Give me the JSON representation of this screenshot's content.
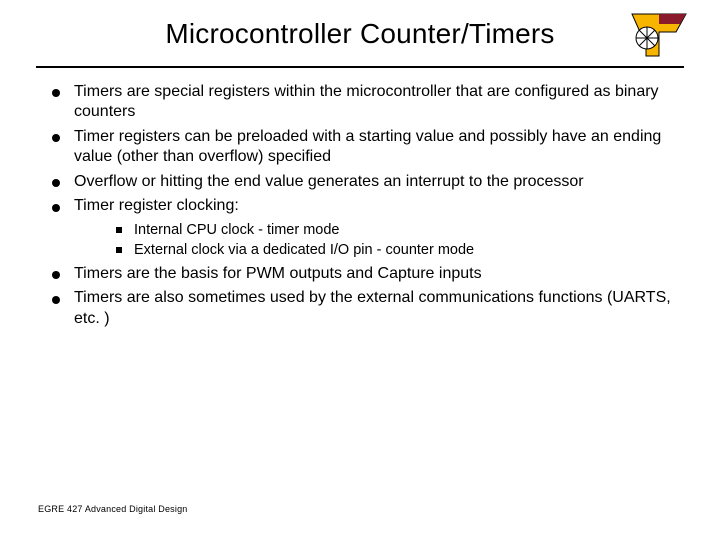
{
  "title": "Microcontroller Counter/Timers",
  "bullets": {
    "b0": "Timers are special registers within the microcontroller that are configured as binary counters",
    "b1": "Timer registers can be preloaded with a starting value and possibly have an ending value (other than overflow) specified",
    "b2": "Overflow or hitting the end value generates an interrupt to the processor",
    "b3": "Timer register clocking:",
    "b4": "Timers are the basis for PWM outputs and Capture inputs",
    "b5": "Timers are also sometimes used by the external communications functions (UARTS, etc. )"
  },
  "subs": {
    "s0": "Internal CPU clock - timer mode",
    "s1": "External clock via a dedicated I/O pin - counter mode"
  },
  "footer": "EGRE 427 Advanced Digital Design",
  "logo": {
    "name": "vt-logo"
  }
}
